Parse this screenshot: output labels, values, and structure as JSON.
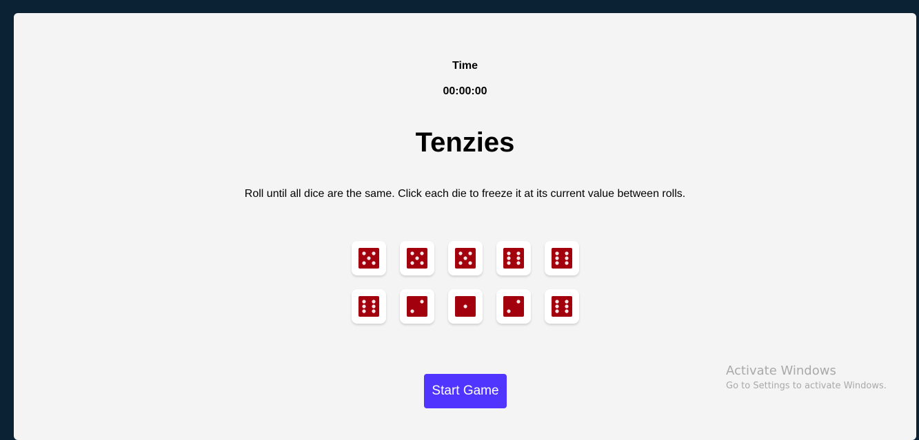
{
  "timer": {
    "label": "Time",
    "value": "00:00:00"
  },
  "title": "Tenzies",
  "instructions": "Roll until all dice are the same. Click each die to freeze it at its current value between rolls.",
  "dice": [
    5,
    5,
    5,
    6,
    6,
    6,
    2,
    1,
    2,
    6
  ],
  "colors": {
    "die_face": "#a3000d",
    "pip": "#f2e6e6",
    "button": "#5035ff",
    "background": "#0b2235",
    "card": "#f4f4f4"
  },
  "buttons": {
    "start_label": "Start Game"
  },
  "watermark": {
    "title": "Activate Windows",
    "subtitle": "Go to Settings to activate Windows."
  }
}
